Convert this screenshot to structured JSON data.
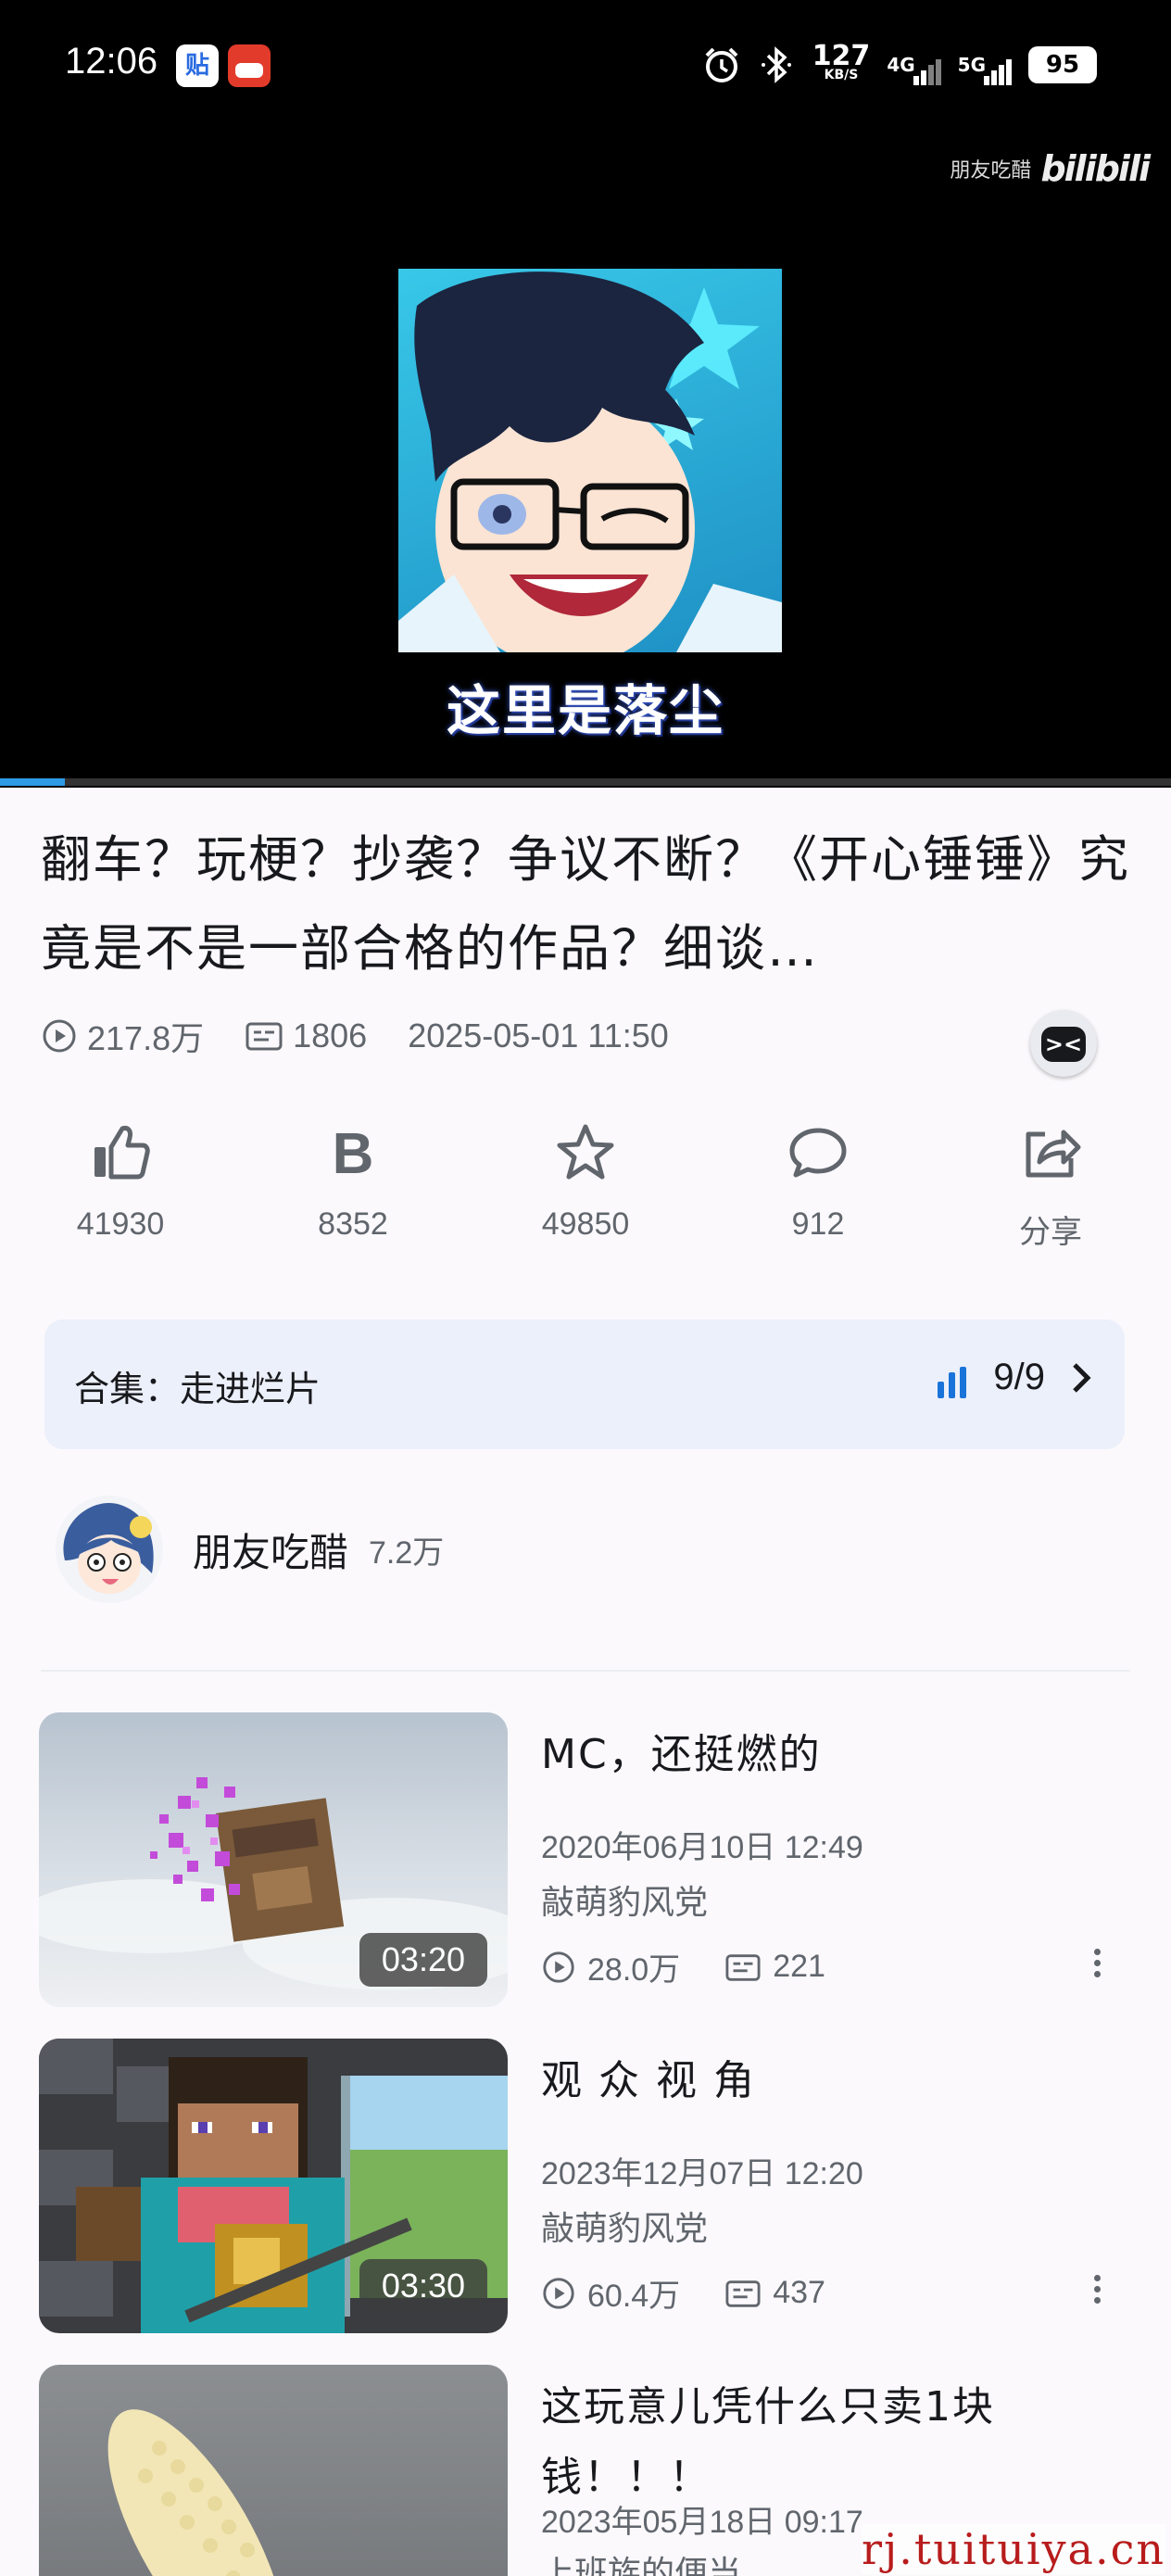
{
  "status_bar": {
    "time": "12:06",
    "app1_glyph": "贴",
    "net_speed": "127",
    "net_speed_unit": "KB/S",
    "net_4g": "4G",
    "net_5g": "5G",
    "battery": "95",
    "icons": [
      "alarm-icon",
      "bluetooth-icon",
      "signal-icon",
      "battery-icon"
    ]
  },
  "player": {
    "watermark_user": "朋友吃醋",
    "watermark_brand": "bilibili",
    "subtitle": "这里是落尘",
    "progress": 0.055
  },
  "video": {
    "title": "翻车？玩梗？抄袭？争议不断？《开心锤锤》究竟是不是一部合格的作品？细谈…",
    "views": "217.8万",
    "danmaku": "1806",
    "date": "2025-05-01 11:50"
  },
  "actions": [
    {
      "name": "like",
      "label": "41930"
    },
    {
      "name": "coin",
      "label": "8352"
    },
    {
      "name": "favorite",
      "label": "49850"
    },
    {
      "name": "comment",
      "label": "912"
    },
    {
      "name": "share",
      "label": "分享"
    }
  ],
  "collection": {
    "label": "合集：走进烂片",
    "progress": "9/9"
  },
  "uploader": {
    "name": "朋友吃醋",
    "fans": "7.2万"
  },
  "related": [
    {
      "title": "MC，还挺燃的",
      "date": "2020年06月10日  12:49",
      "author": "敲萌豹风党",
      "views": "28.0万",
      "danmaku": "221",
      "duration": "03:20"
    },
    {
      "title": "观 众 视 角",
      "date": "2023年12月07日  12:20",
      "author": "敲萌豹风党",
      "views": "60.4万",
      "danmaku": "437",
      "duration": "03:30"
    },
    {
      "title": "这玩意儿凭什么只卖1块钱！！！",
      "date": "2023年05月18日  09:17",
      "author": "上班族的便当",
      "views": "",
      "danmaku": "",
      "duration": ""
    }
  ],
  "site_watermark": "rj.tuituiya.cn"
}
